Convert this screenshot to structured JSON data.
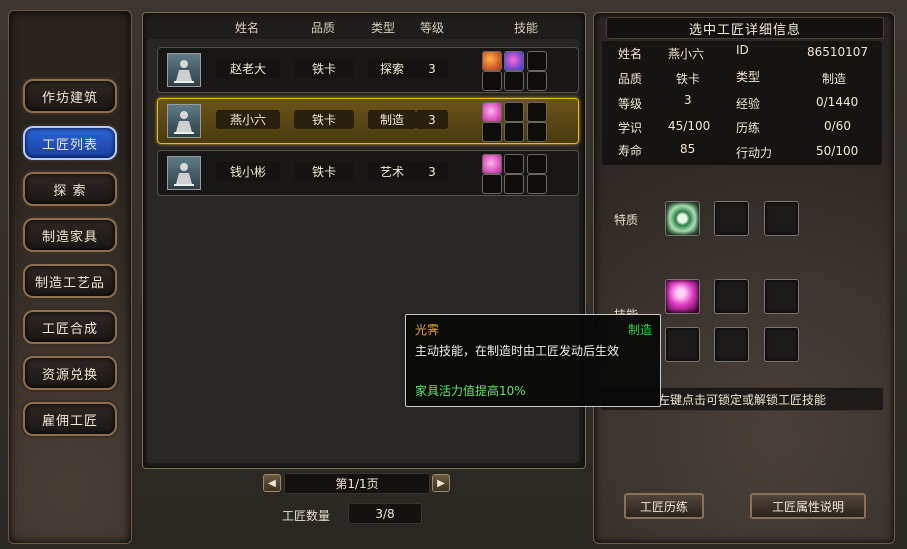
{
  "menu": {
    "items": [
      "作坊建筑",
      "工匠列表",
      "探  索",
      "制造家具",
      "制造工艺品",
      "工匠合成",
      "资源兑换",
      "雇佣工匠"
    ],
    "active_index": 1
  },
  "list": {
    "headers": {
      "name": "姓名",
      "quality": "品质",
      "type": "类型",
      "level": "等级",
      "skills": "技能"
    },
    "rows": [
      {
        "name": "赵老大",
        "quality": "铁卡",
        "type": "探索",
        "level": "3"
      },
      {
        "name": "燕小六",
        "quality": "铁卡",
        "type": "制造",
        "level": "3"
      },
      {
        "name": "钱小彬",
        "quality": "铁卡",
        "type": "艺术",
        "level": "3"
      }
    ],
    "selected_index": 1
  },
  "pager": {
    "page": "第1/1页",
    "prev_icon": "arrow-left-icon",
    "next_icon": "arrow-right-icon"
  },
  "count": {
    "label": "工匠数量",
    "value": "3/8"
  },
  "detail": {
    "title": "选中工匠详细信息",
    "fields": {
      "name_label": "姓名",
      "name": "燕小六",
      "id_label": "ID",
      "id": "86510107",
      "quality_label": "品质",
      "quality": "铁卡",
      "type_label": "类型",
      "type": "制造",
      "level_label": "等级",
      "level": "3",
      "exp_label": "经验",
      "exp": "0/1440",
      "knowledge_label": "学识",
      "knowledge": "45/100",
      "practice_label": "历练",
      "practice": "0/60",
      "life_label": "寿命",
      "life": "85",
      "action_label": "行动力",
      "action": "50/100"
    },
    "trait_label": "特质",
    "skill_label": "技能",
    "hint": "左键点击可锁定或解锁工匠技能",
    "buttons": {
      "practice": "工匠历练",
      "attributes": "工匠属性说明"
    }
  },
  "tooltip": {
    "name": "光霁",
    "type": "制造",
    "desc": "主动技能，在制造时由工匠发动后生效",
    "effect": "家具活力值提高10%"
  }
}
